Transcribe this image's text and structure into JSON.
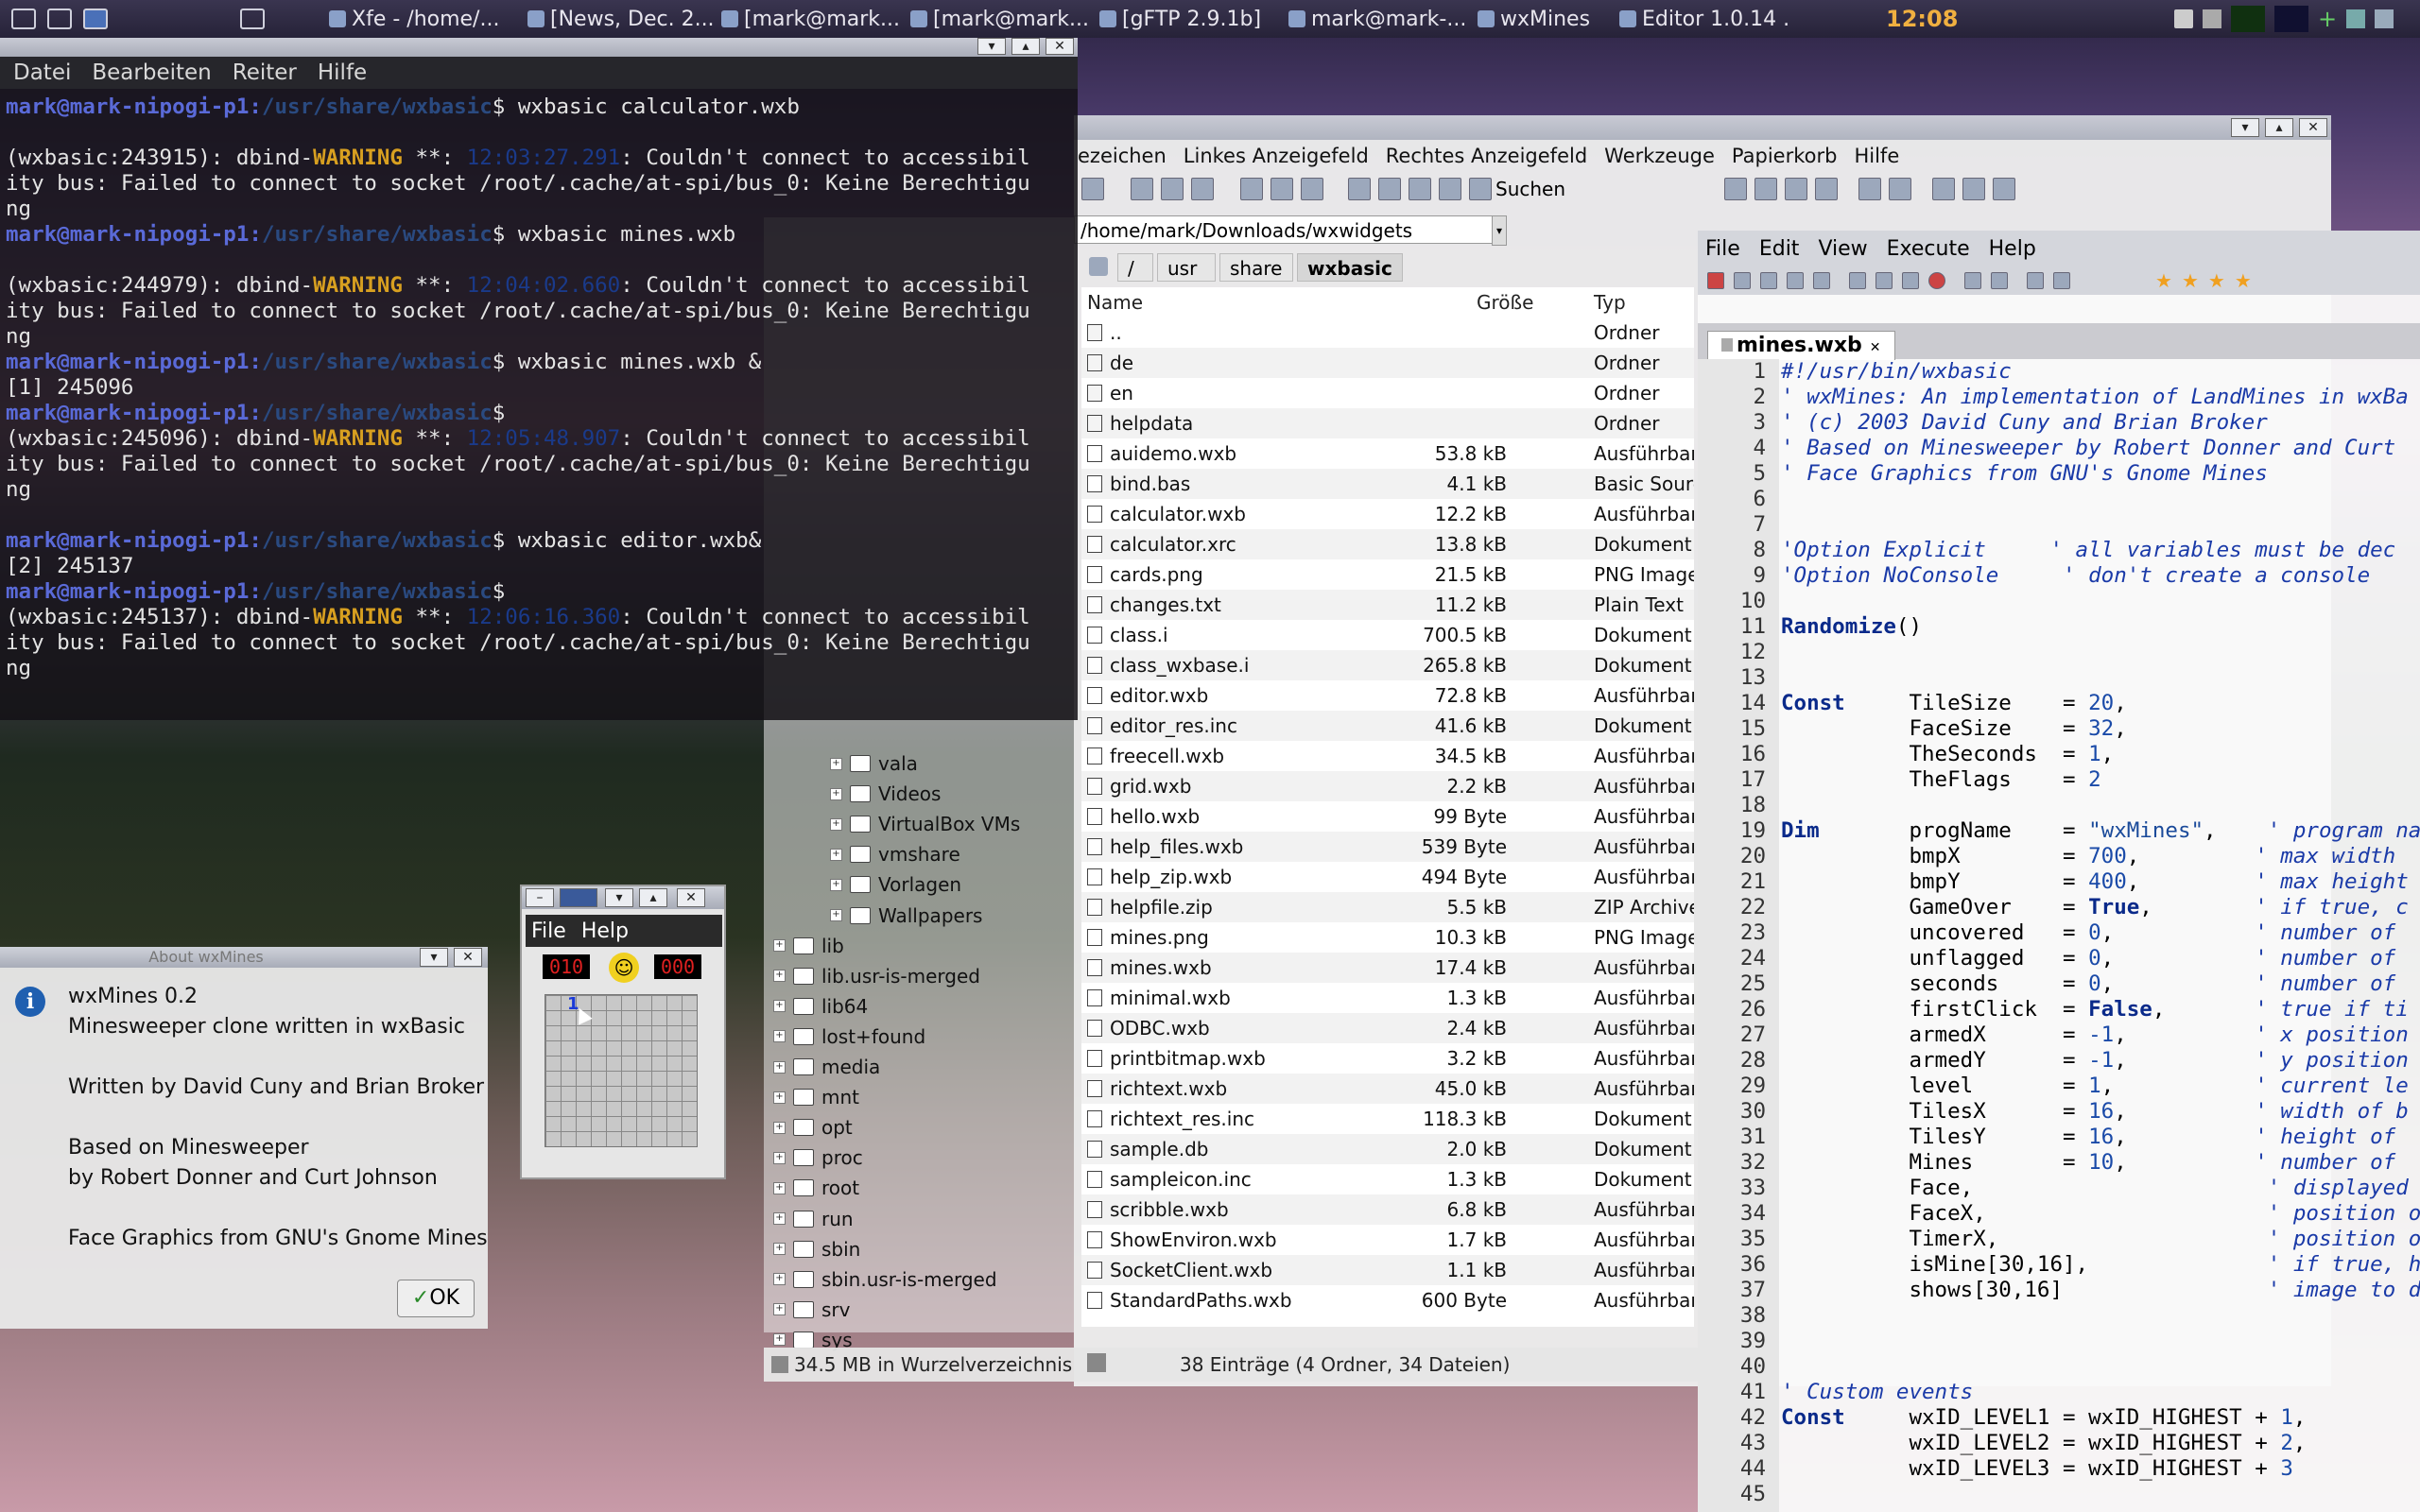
{
  "taskbar": {
    "tasks": [
      "Xfe - /home/...",
      "[News, Dec. 2...",
      "[mark@mark...",
      "[mark@mark...",
      "[gFTP 2.9.1b]",
      "mark@mark-...",
      "wxMines",
      "Editor 1.0.14 ..."
    ],
    "clock": "12:08"
  },
  "terminal": {
    "menu": [
      "Datei",
      "Bearbeiten",
      "Reiter",
      "Hilfe"
    ],
    "user": "mark@mark-nipogi-p1",
    "dir": "/usr/share/wxbasic",
    "lines": [
      {
        "kind": "cmd",
        "text": "wxbasic calculator.wxb"
      },
      {
        "kind": "blank"
      },
      {
        "kind": "warn",
        "pid": "(wxbasic:243915): dbind-",
        "word": "WARNING",
        "rest": " **: ",
        "ts": "12:03:27.291",
        "msg": ": Couldn't connect to accessibil"
      },
      {
        "kind": "plain",
        "text": "ity bus: Failed to connect to socket /root/.cache/at-spi/bus_0: Keine Berechtigu"
      },
      {
        "kind": "plain",
        "text": "ng"
      },
      {
        "kind": "cmd",
        "text": "wxbasic mines.wxb"
      },
      {
        "kind": "blank"
      },
      {
        "kind": "warn",
        "pid": "(wxbasic:244979): dbind-",
        "word": "WARNING",
        "rest": " **: ",
        "ts": "12:04:02.660",
        "msg": ": Couldn't connect to accessibil"
      },
      {
        "kind": "plain",
        "text": "ity bus: Failed to connect to socket /root/.cache/at-spi/bus_0: Keine Berechtigu"
      },
      {
        "kind": "plain",
        "text": "ng"
      },
      {
        "kind": "cmd",
        "text": "wxbasic mines.wxb &"
      },
      {
        "kind": "plain",
        "text": "[1] 245096"
      },
      {
        "kind": "cmd",
        "text": ""
      },
      {
        "kind": "warn",
        "pid": "(wxbasic:245096): dbind-",
        "word": "WARNING",
        "rest": " **: ",
        "ts": "12:05:48.907",
        "msg": ": Couldn't connect to accessibil"
      },
      {
        "kind": "plain",
        "text": "ity bus: Failed to connect to socket /root/.cache/at-spi/bus_0: Keine Berechtigu"
      },
      {
        "kind": "plain",
        "text": "ng"
      },
      {
        "kind": "blank"
      },
      {
        "kind": "cmd",
        "text": "wxbasic editor.wxb&"
      },
      {
        "kind": "plain",
        "text": "[2] 245137"
      },
      {
        "kind": "cmd",
        "text": ""
      },
      {
        "kind": "warn",
        "pid": "(wxbasic:245137): dbind-",
        "word": "WARNING",
        "rest": " **: ",
        "ts": "12:06:16.360",
        "msg": ": Couldn't connect to accessibil"
      },
      {
        "kind": "plain",
        "text": "ity bus: Failed to connect to socket /root/.cache/at-spi/bus_0: Keine Berechtigu"
      },
      {
        "kind": "plain",
        "text": "ng"
      }
    ]
  },
  "filemanager": {
    "menu": [
      "ezeichen",
      "Linkes Anzeigefeld",
      "Rechtes Anzeigefeld",
      "Werkzeuge",
      "Papierkorb",
      "Hilfe"
    ],
    "search_label": "Suchen",
    "address": "/home/mark/Downloads/wxwidgets",
    "crumbs": [
      "/",
      "usr",
      "share",
      "wxbasic"
    ],
    "columns": {
      "name": "Name",
      "size": "Größe",
      "type": "Typ"
    },
    "tree": [
      {
        "label": "vala",
        "exp": "+",
        "icon": "folder"
      },
      {
        "label": "Videos",
        "exp": "+",
        "icon": "folder"
      },
      {
        "label": "VirtualBox VMs",
        "exp": "+",
        "icon": "folder"
      },
      {
        "label": "vmshare",
        "exp": "+",
        "icon": "folder"
      },
      {
        "label": "Vorlagen",
        "exp": "+",
        "icon": "folder"
      },
      {
        "label": "Wallpapers",
        "exp": "+",
        "icon": "folder"
      },
      {
        "label": "lib",
        "exp": "+",
        "icon": "link"
      },
      {
        "label": "lib.usr-is-merged",
        "exp": "+",
        "icon": "folder"
      },
      {
        "label": "lib64",
        "exp": "+",
        "icon": "link"
      },
      {
        "label": "lost+found",
        "exp": "+",
        "icon": "lock"
      },
      {
        "label": "media",
        "exp": "+",
        "icon": "folder"
      },
      {
        "label": "mnt",
        "exp": "+",
        "icon": "folder"
      },
      {
        "label": "opt",
        "exp": "+",
        "icon": "folder"
      },
      {
        "label": "proc",
        "exp": "+",
        "icon": "folder"
      },
      {
        "label": "root",
        "exp": "+",
        "icon": "lock"
      },
      {
        "label": "run",
        "exp": "+",
        "icon": "folder"
      },
      {
        "label": "sbin",
        "exp": "+",
        "icon": "link"
      },
      {
        "label": "sbin.usr-is-merged",
        "exp": "+",
        "icon": "folder"
      },
      {
        "label": "srv",
        "exp": "+",
        "icon": "folder"
      },
      {
        "label": "sys",
        "exp": "+",
        "icon": "folder"
      }
    ],
    "files": [
      {
        "name": "..",
        "size": "",
        "type": "Ordner"
      },
      {
        "name": "de",
        "size": "",
        "type": "Ordner"
      },
      {
        "name": "en",
        "size": "",
        "type": "Ordner"
      },
      {
        "name": "helpdata",
        "size": "",
        "type": "Ordner"
      },
      {
        "name": "auidemo.wxb",
        "size": "53.8 kB",
        "type": "Ausführbar"
      },
      {
        "name": "bind.bas",
        "size": "4.1 kB",
        "type": "Basic Sourc"
      },
      {
        "name": "calculator.wxb",
        "size": "12.2 kB",
        "type": "Ausführbar"
      },
      {
        "name": "calculator.xrc",
        "size": "13.8 kB",
        "type": "Dokument"
      },
      {
        "name": "cards.png",
        "size": "21.5 kB",
        "type": "PNG Image"
      },
      {
        "name": "changes.txt",
        "size": "11.2 kB",
        "type": "Plain Text"
      },
      {
        "name": "class.i",
        "size": "700.5 kB",
        "type": "Dokument"
      },
      {
        "name": "class_wxbase.i",
        "size": "265.8 kB",
        "type": "Dokument"
      },
      {
        "name": "editor.wxb",
        "size": "72.8 kB",
        "type": "Ausführbar"
      },
      {
        "name": "editor_res.inc",
        "size": "41.6 kB",
        "type": "Dokument"
      },
      {
        "name": "freecell.wxb",
        "size": "34.5 kB",
        "type": "Ausführbar"
      },
      {
        "name": "grid.wxb",
        "size": "2.2 kB",
        "type": "Ausführbar"
      },
      {
        "name": "hello.wxb",
        "size": "99 Byte",
        "type": "Ausführbar"
      },
      {
        "name": "help_files.wxb",
        "size": "539 Byte",
        "type": "Ausführbar"
      },
      {
        "name": "help_zip.wxb",
        "size": "494 Byte",
        "type": "Ausführbar"
      },
      {
        "name": "helpfile.zip",
        "size": "5.5 kB",
        "type": "ZIP Archive"
      },
      {
        "name": "mines.png",
        "size": "10.3 kB",
        "type": "PNG Image"
      },
      {
        "name": "mines.wxb",
        "size": "17.4 kB",
        "type": "Ausführbar"
      },
      {
        "name": "minimal.wxb",
        "size": "1.3 kB",
        "type": "Ausführbar"
      },
      {
        "name": "ODBC.wxb",
        "size": "2.4 kB",
        "type": "Ausführbar"
      },
      {
        "name": "printbitmap.wxb",
        "size": "3.2 kB",
        "type": "Ausführbar"
      },
      {
        "name": "richtext.wxb",
        "size": "45.0 kB",
        "type": "Ausführbar"
      },
      {
        "name": "richtext_res.inc",
        "size": "118.3 kB",
        "type": "Dokument"
      },
      {
        "name": "sample.db",
        "size": "2.0 kB",
        "type": "Dokument"
      },
      {
        "name": "sampleicon.inc",
        "size": "1.3 kB",
        "type": "Dokument"
      },
      {
        "name": "scribble.wxb",
        "size": "6.8 kB",
        "type": "Ausführbar"
      },
      {
        "name": "ShowEnviron.wxb",
        "size": "1.7 kB",
        "type": "Ausführbar"
      },
      {
        "name": "SocketClient.wxb",
        "size": "1.1 kB",
        "type": "Ausführbar"
      },
      {
        "name": "StandardPaths.wxb",
        "size": "600 Byte",
        "type": "Ausführbar"
      }
    ],
    "status_left": "34.5 MB in Wurzelverzeichnis",
    "status_right": "38 Einträge (4 Ordner, 34 Dateien)"
  },
  "editor": {
    "menu": [
      "File",
      "Edit",
      "View",
      "Execute",
      "Help"
    ],
    "tab": "mines.wxb",
    "code": [
      [
        [
          "cm",
          "#!/usr/bin/wxbasic"
        ]
      ],
      [
        [
          "cm",
          "' wxMines: An implementation of LandMines in wxBa"
        ]
      ],
      [
        [
          "cm",
          "' (c) 2003 David Cuny and Brian Broker"
        ]
      ],
      [
        [
          "cm",
          "' Based on Minesweeper by Robert Donner and Curt"
        ]
      ],
      [
        [
          "cm",
          "' Face Graphics from GNU's Gnome Mines"
        ]
      ],
      [],
      [],
      [
        [
          "cm",
          "'Option Explicit     ' all variables must be dec"
        ]
      ],
      [
        [
          "cm",
          "'Option NoConsole     ' don't create a console"
        ]
      ],
      [],
      [
        [
          "kw",
          "Randomize"
        ],
        [
          "pl",
          "()"
        ]
      ],
      [],
      [],
      [
        [
          "kw",
          "Const"
        ],
        [
          "pl",
          "     TileSize    = "
        ],
        [
          "nu",
          "20"
        ],
        [
          "pl",
          ","
        ]
      ],
      [
        [
          "pl",
          "          FaceSize    = "
        ],
        [
          "nu",
          "32"
        ],
        [
          "pl",
          ","
        ]
      ],
      [
        [
          "pl",
          "          TheSeconds  = "
        ],
        [
          "nu",
          "1"
        ],
        [
          "pl",
          ","
        ]
      ],
      [
        [
          "pl",
          "          TheFlags    = "
        ],
        [
          "nu",
          "2"
        ]
      ],
      [],
      [
        [
          "kw",
          "Dim"
        ],
        [
          "pl",
          "       progName    = "
        ],
        [
          "st",
          "\"wxMines\""
        ],
        [
          "pl",
          ",    "
        ],
        [
          "cm",
          "' program na"
        ]
      ],
      [
        [
          "pl",
          "          bmpX        = "
        ],
        [
          "nu",
          "700"
        ],
        [
          "pl",
          ",         "
        ],
        [
          "cm",
          "' max width"
        ]
      ],
      [
        [
          "pl",
          "          bmpY        = "
        ],
        [
          "nu",
          "400"
        ],
        [
          "pl",
          ",         "
        ],
        [
          "cm",
          "' max height"
        ]
      ],
      [
        [
          "pl",
          "          GameOver    = "
        ],
        [
          "kw",
          "True"
        ],
        [
          "pl",
          ",        "
        ],
        [
          "cm",
          "' if true, c"
        ]
      ],
      [
        [
          "pl",
          "          uncovered   = "
        ],
        [
          "nu",
          "0"
        ],
        [
          "pl",
          ",           "
        ],
        [
          "cm",
          "' number of"
        ]
      ],
      [
        [
          "pl",
          "          unflagged   = "
        ],
        [
          "nu",
          "0"
        ],
        [
          "pl",
          ",           "
        ],
        [
          "cm",
          "' number of"
        ]
      ],
      [
        [
          "pl",
          "          seconds     = "
        ],
        [
          "nu",
          "0"
        ],
        [
          "pl",
          ",           "
        ],
        [
          "cm",
          "' number of"
        ]
      ],
      [
        [
          "pl",
          "          firstClick  = "
        ],
        [
          "kw",
          "False"
        ],
        [
          "pl",
          ",       "
        ],
        [
          "cm",
          "' true if ti"
        ]
      ],
      [
        [
          "pl",
          "          armedX      = "
        ],
        [
          "nu",
          "-1"
        ],
        [
          "pl",
          ",          "
        ],
        [
          "cm",
          "' x position"
        ]
      ],
      [
        [
          "pl",
          "          armedY      = "
        ],
        [
          "nu",
          "-1"
        ],
        [
          "pl",
          ",          "
        ],
        [
          "cm",
          "' y position"
        ]
      ],
      [
        [
          "pl",
          "          level       = "
        ],
        [
          "nu",
          "1"
        ],
        [
          "pl",
          ",           "
        ],
        [
          "cm",
          "' current le"
        ]
      ],
      [
        [
          "pl",
          "          TilesX      = "
        ],
        [
          "nu",
          "16"
        ],
        [
          "pl",
          ",          "
        ],
        [
          "cm",
          "' width of b"
        ]
      ],
      [
        [
          "pl",
          "          TilesY      = "
        ],
        [
          "nu",
          "16"
        ],
        [
          "pl",
          ",          "
        ],
        [
          "cm",
          "' height of"
        ]
      ],
      [
        [
          "pl",
          "          Mines       = "
        ],
        [
          "nu",
          "10"
        ],
        [
          "pl",
          ",          "
        ],
        [
          "cm",
          "' number of"
        ]
      ],
      [
        [
          "pl",
          "          Face,                       "
        ],
        [
          "cm",
          "' displayed"
        ]
      ],
      [
        [
          "pl",
          "          FaceX,                      "
        ],
        [
          "cm",
          "' position o"
        ]
      ],
      [
        [
          "pl",
          "          TimerX,                     "
        ],
        [
          "cm",
          "' position o"
        ]
      ],
      [
        [
          "pl",
          "          isMine[30,16],              "
        ],
        [
          "cm",
          "' if true, h"
        ]
      ],
      [
        [
          "pl",
          "          shows[30,16]                "
        ],
        [
          "cm",
          "' image to d"
        ]
      ],
      [],
      [],
      [],
      [
        [
          "cm",
          "' Custom events"
        ]
      ],
      [
        [
          "kw",
          "Const"
        ],
        [
          "pl",
          "     wxID_LEVEL1 = wxID_HIGHEST + "
        ],
        [
          "nu",
          "1"
        ],
        [
          "pl",
          ","
        ]
      ],
      [
        [
          "pl",
          "          wxID_LEVEL2 = wxID_HIGHEST + "
        ],
        [
          "nu",
          "2"
        ],
        [
          "pl",
          ","
        ]
      ],
      [
        [
          "pl",
          "          wxID_LEVEL3 = wxID_HIGHEST + "
        ],
        [
          "nu",
          "3"
        ]
      ],
      []
    ]
  },
  "about": {
    "title": "About wxMines",
    "lines": [
      "wxMines 0.2",
      "Minesweeper clone written in wxBasic",
      "Written by David Cuny and Brian Broker",
      "Based on Minesweeper",
      "by Robert Donner and Curt Johnson",
      "Face Graphics from GNU's Gnome Mines"
    ],
    "ok": "OK"
  },
  "mines": {
    "menu": [
      "File",
      "Help"
    ],
    "mines_left": "010",
    "timer": "000",
    "revealed_number": "1"
  },
  "colors": {
    "accent": "#1f5fb0",
    "warning": "#d8a020",
    "prompt_user": "#5a6ad8",
    "lcd": "#e02020"
  }
}
